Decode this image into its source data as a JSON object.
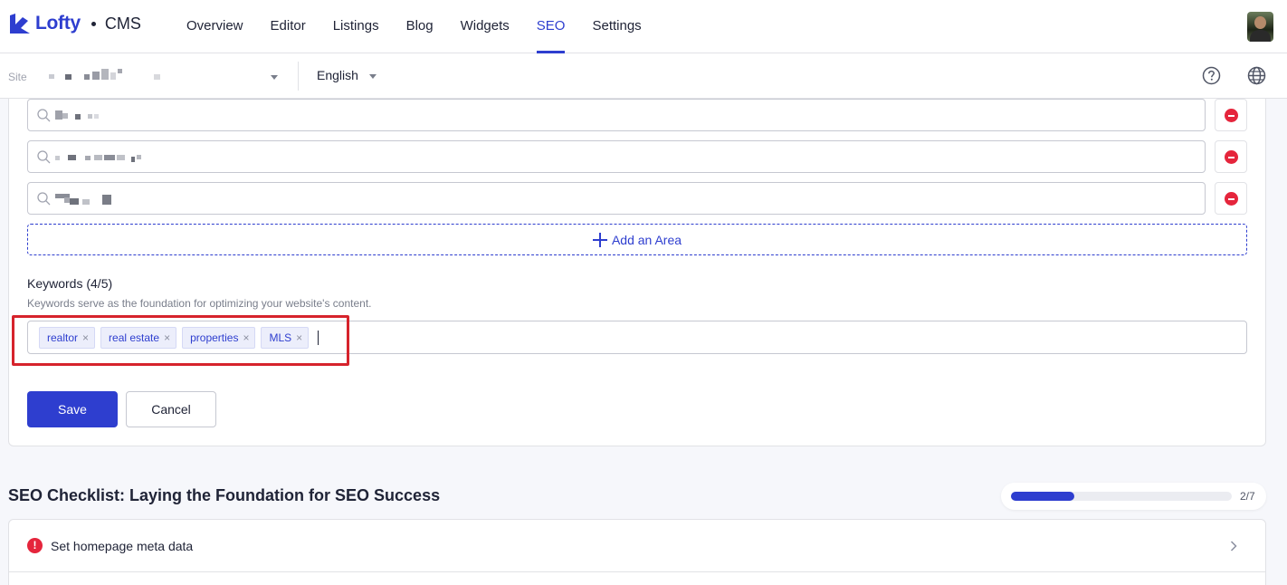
{
  "nav": {
    "logo_text": "Lofty",
    "product": "CMS",
    "items": [
      {
        "label": "Overview"
      },
      {
        "label": "Editor"
      },
      {
        "label": "Listings"
      },
      {
        "label": "Blog"
      },
      {
        "label": "Widgets"
      },
      {
        "label": "SEO"
      },
      {
        "label": "Settings"
      }
    ],
    "active_index": 5
  },
  "sitebar": {
    "site_label": "Site",
    "language": "English"
  },
  "areas": {
    "add_label": "Add an Area"
  },
  "keywords": {
    "title": "Keywords (4/5)",
    "description": "Keywords serve as the foundation for optimizing your website's content.",
    "tags": [
      "realtor",
      "real estate",
      "properties",
      "MLS"
    ],
    "remove_glyph": "×"
  },
  "actions": {
    "save_label": "Save",
    "cancel_label": "Cancel"
  },
  "checklist": {
    "title": "SEO Checklist: Laying the Foundation for SEO Success",
    "progress_text": "2/7",
    "progress_fraction": 0.2857,
    "items": [
      {
        "label": "Set homepage meta data",
        "status": "warning"
      }
    ]
  },
  "colors": {
    "accent": "#2e3ecf",
    "danger": "#e5253c",
    "highlight": "#d6232c"
  },
  "icons": [
    "lofty-logo-icon",
    "help-icon",
    "globe-icon",
    "search-icon",
    "remove-circle-icon",
    "plus-icon",
    "close-icon",
    "warning-icon",
    "chevron-right-icon",
    "caret-down-icon"
  ]
}
